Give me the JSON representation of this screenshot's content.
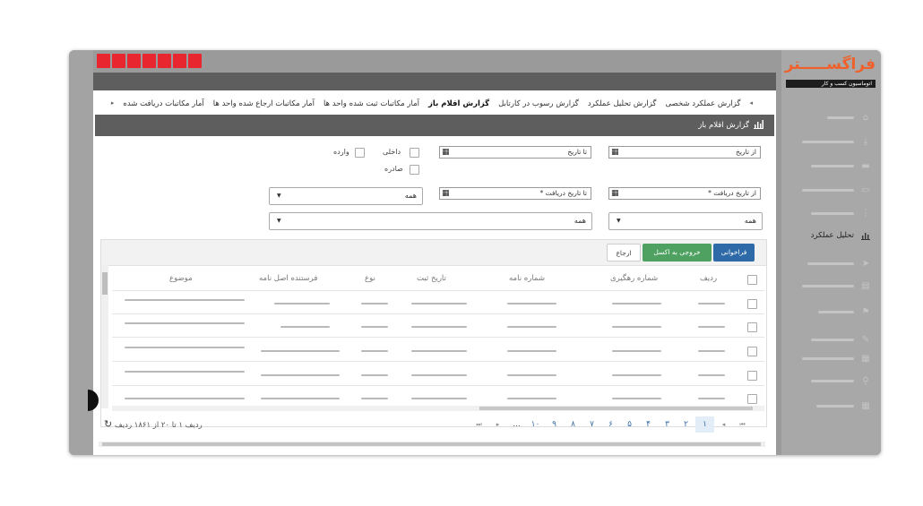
{
  "brand": {
    "logo": "فراگســـــتر",
    "tagline": "اتوماسیون کسب و کار"
  },
  "sidebar": {
    "items": [
      {
        "icon": "home-icon",
        "label": ""
      },
      {
        "icon": "inbox-icon",
        "label": ""
      },
      {
        "icon": "folder-icon",
        "label": ""
      },
      {
        "icon": "archive-icon",
        "label": ""
      },
      {
        "icon": "sitemap-icon",
        "label": ""
      },
      {
        "icon": "bar-chart-icon",
        "label": "تحلیل عملکرد"
      },
      {
        "icon": "send-icon",
        "label": ""
      },
      {
        "icon": "grid-icon",
        "label": ""
      },
      {
        "icon": "flag-icon",
        "label": ""
      },
      {
        "icon": "edit-icon",
        "label": ""
      },
      {
        "icon": "table-icon",
        "label": ""
      },
      {
        "icon": "search-icon",
        "label": ""
      },
      {
        "icon": "calendar-icon",
        "label": ""
      }
    ]
  },
  "tabs": [
    {
      "label": "گزارش عملکرد شخصی",
      "active": false
    },
    {
      "label": "گزارش تحلیل عملکرد",
      "active": false
    },
    {
      "label": "گزارش رسوب در کارتابل",
      "active": false
    },
    {
      "label": "گزارش اقلام باز",
      "active": true
    },
    {
      "label": "آمار مکاتبات ثبت شده واحد ها",
      "active": false
    },
    {
      "label": "آمار مکاتبات ارجاع شده واحد ها",
      "active": false
    },
    {
      "label": "آمار مکاتبات دریافت شده",
      "active": false
    }
  ],
  "panel": {
    "title": "گزارش اقلام باز"
  },
  "filters": {
    "from_date_placeholder": "از تاریخ",
    "to_date_placeholder": "تا تاریخ",
    "from_receive_placeholder": "از تاریخ دریافت *",
    "to_receive_placeholder": "تا تاریخ دریافت *",
    "internal_label": "داخلی",
    "incoming_label": "وارده",
    "outgoing_label": "صادره",
    "select1_value": "همه",
    "select2_value": "همه",
    "select3_value": "همه"
  },
  "toolbar": {
    "fetch_label": "فراخوانی",
    "excel_label": "خروجی به اکسل",
    "refer_label": "ارجاع"
  },
  "grid": {
    "columns": [
      "ردیف",
      "شماره رهگیری",
      "شماره نامه",
      "تاریخ ثبت",
      "نوع",
      "فرستنده اصل نامه",
      "موضوع"
    ],
    "row_count": 5
  },
  "pagination": {
    "pages": [
      "۱",
      "۲",
      "۳",
      "۴",
      "۵",
      "۶",
      "۷",
      "۸",
      "۹",
      "۱۰",
      "..."
    ],
    "active_page": "۱",
    "summary": "ردیف ۱ تا ۲۰ از ۱۸۶۱ ردیف"
  },
  "colors": {
    "brand_orange": "#f0602a",
    "toolbar_dark": "#5e5e5e",
    "btn_blue": "#2e6aa7",
    "btn_green": "#4ea160"
  }
}
